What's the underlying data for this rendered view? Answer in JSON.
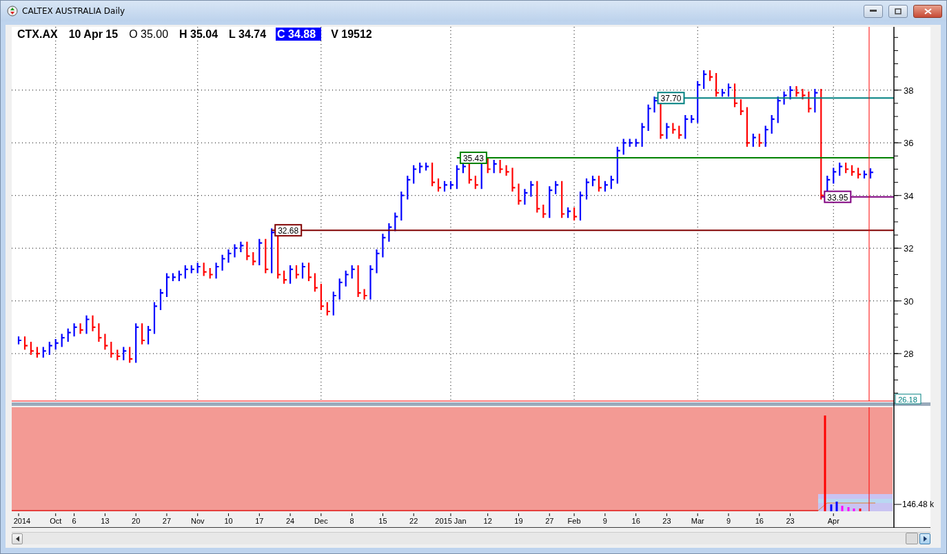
{
  "window": {
    "title": "CALTEX AUSTRALIA Daily"
  },
  "header": [
    {
      "text": "CTX.AX",
      "kind": "bold"
    },
    {
      "text": "10 Apr 15",
      "kind": "bold"
    },
    {
      "text": "O 35.00",
      "kind": "plain"
    },
    {
      "text": "H 35.04",
      "kind": "bold"
    },
    {
      "text": "L 34.74",
      "kind": "bold"
    },
    {
      "text": "C 34.88",
      "kind": "highlight"
    },
    {
      "text": "V 19512",
      "kind": "bold"
    }
  ],
  "price_chart": {
    "axis_labels": [
      "38",
      "36",
      "34",
      "32",
      "30",
      "28"
    ],
    "axis_min_label": "26.18",
    "levels": [
      {
        "label": "32.68",
        "color": "#800000"
      },
      {
        "label": "35.43",
        "color": "#008000"
      },
      {
        "label": "37.70",
        "color": "#008080"
      },
      {
        "label": "33.95",
        "color": "#800080"
      }
    ]
  },
  "date_axis": {
    "labels": [
      "2014",
      "Oct",
      "6",
      "13",
      "20",
      "27",
      "Nov",
      "10",
      "17",
      "24",
      "Dec",
      "8",
      "15",
      "22",
      "2015 Jan",
      "12",
      "19",
      "27",
      "Feb",
      "9",
      "16",
      "23",
      "Mar",
      "9",
      "16",
      "23",
      "Apr"
    ]
  },
  "volume_panel": {
    "axis_label": "146.48 k"
  }
}
